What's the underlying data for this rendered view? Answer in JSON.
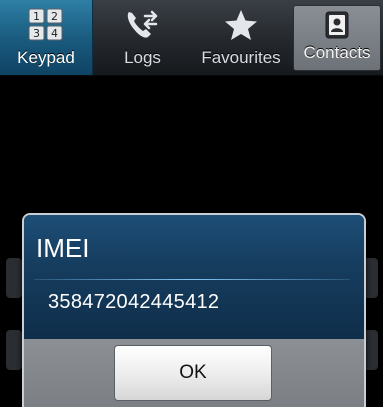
{
  "tabs": {
    "keypad": {
      "label": "Keypad",
      "icon": "keypad-icon",
      "selected": true
    },
    "logs": {
      "label": "Logs",
      "icon": "call-logs-icon"
    },
    "favourites": {
      "label": "Favourites",
      "icon": "star-icon"
    },
    "contacts": {
      "label": "Contacts",
      "icon": "contact-card-icon"
    }
  },
  "keypad_icon_digits": [
    "1",
    "2",
    "3",
    "4"
  ],
  "dialog": {
    "title": "IMEI",
    "message": "358472042445412",
    "ok_label": "OK"
  },
  "colors": {
    "accent": "#1a5c80",
    "dialog_header": "#163d5f",
    "divider": "#7fc4f2"
  }
}
